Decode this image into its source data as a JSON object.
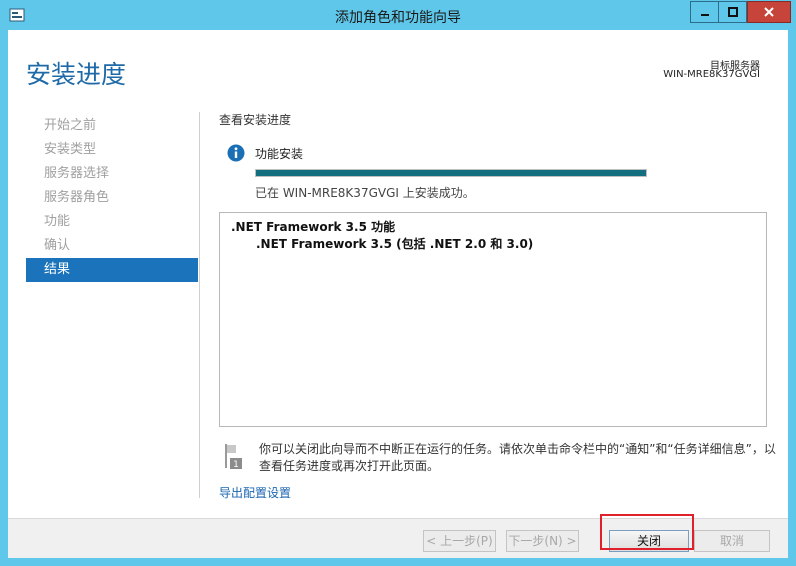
{
  "window": {
    "title": "添加角色和功能向导"
  },
  "header": {
    "page_title": "安装进度",
    "server_label": "目标服务器",
    "server_name": "WIN-MRE8K37GVGI"
  },
  "nav": {
    "items": [
      {
        "label": "开始之前",
        "active": false
      },
      {
        "label": "安装类型",
        "active": false
      },
      {
        "label": "服务器选择",
        "active": false
      },
      {
        "label": "服务器角色",
        "active": false
      },
      {
        "label": "功能",
        "active": false
      },
      {
        "label": "确认",
        "active": false
      },
      {
        "label": "结果",
        "active": true
      }
    ]
  },
  "main": {
    "section_title": "查看安装进度",
    "feature_label": "功能安装",
    "progress_fraction": 1.0,
    "status_text": "已在 WIN-MRE8K37GVGI 上安装成功。",
    "results": [
      ".NET Framework 3.5 功能",
      ".NET Framework 3.5 (包括 .NET 2.0 和 3.0)"
    ],
    "notice": "你可以关闭此向导而不中断正在运行的任务。请依次单击命令栏中的“通知”和“任务详细信息”，以查看任务进度或再次打开此页面。",
    "export_link": "导出配置设置"
  },
  "footer": {
    "prev_label": "< 上一步(P)",
    "next_label": "下一步(N) >",
    "close_label": "关闭",
    "cancel_label": "取消"
  },
  "colors": {
    "title_bar": "#5fc8ea",
    "accent": "#1b74bb",
    "progress": "#136e7f",
    "highlight": "#e0202a"
  }
}
